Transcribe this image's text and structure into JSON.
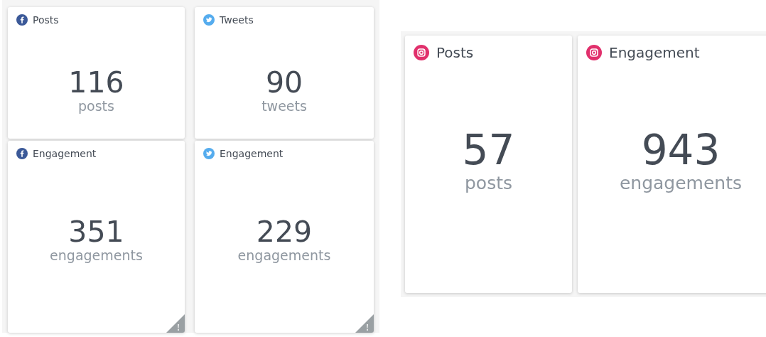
{
  "facebook_twitter_panel": {
    "cards": [
      {
        "kind": "facebook",
        "title": "Posts",
        "value": "116",
        "unit": "posts",
        "warning": false
      },
      {
        "kind": "twitter",
        "title": "Tweets",
        "value": "90",
        "unit": "tweets",
        "warning": false
      },
      {
        "kind": "facebook",
        "title": "Engagement",
        "value": "351",
        "unit": "engagements",
        "warning": true
      },
      {
        "kind": "twitter",
        "title": "Engagement",
        "value": "229",
        "unit": "engagements",
        "warning": true
      }
    ]
  },
  "instagram_panel": {
    "cards": [
      {
        "kind": "instagram",
        "title": "Posts",
        "value": "57",
        "unit": "posts",
        "warning": false
      },
      {
        "kind": "instagram",
        "title": "Engagement",
        "value": "943",
        "unit": "engagements",
        "warning": false
      }
    ]
  }
}
